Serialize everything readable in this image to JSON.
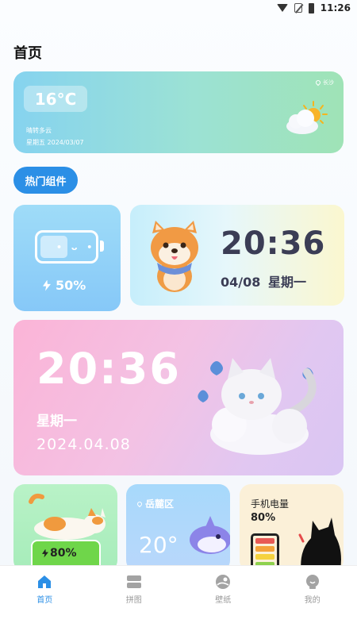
{
  "status_bar": {
    "time": "11:26"
  },
  "page_title": "首页",
  "weather": {
    "temperature": "16°C",
    "description": "晴转多云",
    "date": "星期五 2024/03/07",
    "location": "长沙"
  },
  "section": {
    "label": "热门组件"
  },
  "widgets": {
    "battery": {
      "percent": "50%"
    },
    "dog_clock": {
      "time": "20:36",
      "date": "04/08 星期一"
    },
    "cat_clock": {
      "time": "20:36",
      "weekday": "星期一",
      "date": "2024.04.08"
    },
    "cat_battery": {
      "percent": "80%"
    },
    "dolphin_weather": {
      "location": "岳麓区",
      "temperature": "20°"
    },
    "phone_battery": {
      "label": "手机电量",
      "percent": "80%"
    }
  },
  "tabs": [
    {
      "label": "首页",
      "icon": "home-icon",
      "active": true
    },
    {
      "label": "拼图",
      "icon": "puzzle-icon",
      "active": false
    },
    {
      "label": "壁纸",
      "icon": "wallpaper-icon",
      "active": false
    },
    {
      "label": "我的",
      "icon": "profile-icon",
      "active": false
    }
  ],
  "colors": {
    "accent": "#2b8fe6",
    "inactive": "#9a9a9a"
  }
}
